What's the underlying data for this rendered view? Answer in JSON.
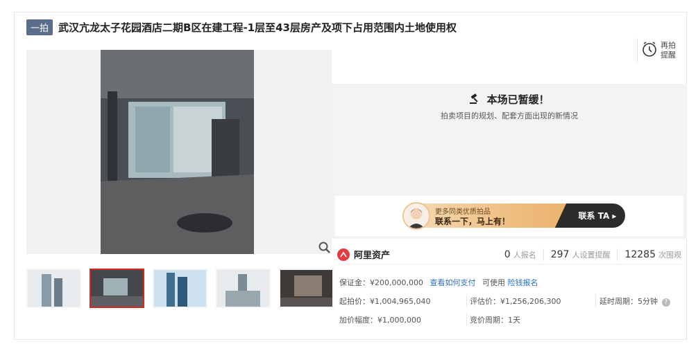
{
  "header": {
    "badge": "一拍",
    "title": "武汉亢龙太子花园酒店二期B区在建工程-1层至43层房产及项下占用范围内土地使用权"
  },
  "remind": {
    "line1": "再拍",
    "line2": "提醒"
  },
  "paused": {
    "title": "本场已暂缓！",
    "subtitle": "拍卖项目的规划、配套方面出现的新情况"
  },
  "banner": {
    "small": "更多同类优质拍品",
    "big": "联系一下，马上有！",
    "button": "联系 TA ▸"
  },
  "platform": {
    "name": "阿里资产"
  },
  "stats": {
    "signups": "0",
    "signups_label": "人报名",
    "reminders": "297",
    "reminders_label": "人设置提醒",
    "views": "12285",
    "views_label": "次围观"
  },
  "deposit": {
    "label": "保证金：¥200,000,000",
    "how_to_pay": "查看如何支付",
    "can_use": "可使用",
    "loan_signup": "险钱报名"
  },
  "prices": {
    "start": "起拍价：¥1,004,965,040",
    "appraisal": "评估价：¥1,256,206,300",
    "delay": "延时周期：5分钟",
    "increment": "加价幅度：¥1,000,000",
    "bid_cycle": "竞价周期：1天"
  },
  "colors": {
    "accent": "#d9261c",
    "link": "#2a6fc9",
    "badge": "#5a6e8c"
  },
  "icons": [
    "alarm-clock-icon",
    "gavel-icon",
    "zoom-icon",
    "help-icon"
  ]
}
